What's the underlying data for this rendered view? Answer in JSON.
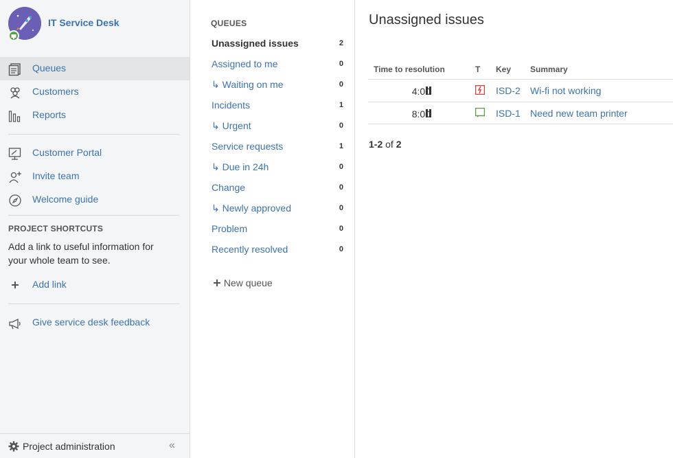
{
  "project": {
    "name": "IT Service Desk",
    "accent": "#3b73af"
  },
  "sidebar": {
    "items": [
      {
        "label": "Queues",
        "icon": "queues-icon",
        "active": true
      },
      {
        "label": "Customers",
        "icon": "customers-icon"
      },
      {
        "label": "Reports",
        "icon": "reports-icon"
      },
      {
        "label": "Customer Portal",
        "icon": "portal-icon"
      },
      {
        "label": "Invite team",
        "icon": "invite-icon"
      },
      {
        "label": "Welcome guide",
        "icon": "compass-icon"
      }
    ],
    "shortcuts": {
      "title": "PROJECT SHORTCUTS",
      "text": "Add a link to useful information for your whole team to see.",
      "add_link": "Add link"
    },
    "feedback": "Give service desk feedback",
    "footer": {
      "label": "Project administration",
      "collapse": "«"
    }
  },
  "queues": {
    "title": "QUEUES",
    "items": [
      {
        "label": "Unassigned issues",
        "count": "2",
        "active": true
      },
      {
        "label": "Assigned to me",
        "count": "0"
      },
      {
        "label": "↳ Waiting on me",
        "count": "0"
      },
      {
        "label": "Incidents",
        "count": "1"
      },
      {
        "label": "↳ Urgent",
        "count": "0"
      },
      {
        "label": "Service requests",
        "count": "1"
      },
      {
        "label": "↳ Due in 24h",
        "count": "0"
      },
      {
        "label": "Change",
        "count": "0"
      },
      {
        "label": "↳ Newly approved",
        "count": "0"
      },
      {
        "label": "Problem",
        "count": "0"
      },
      {
        "label": "Recently resolved",
        "count": "0"
      }
    ],
    "new_queue": "New queue"
  },
  "main": {
    "title": "Unassigned issues",
    "columns": {
      "time": "Time to resolution",
      "type": "T",
      "key": "Key",
      "summary": "Summary"
    },
    "rows": [
      {
        "time": "4:00",
        "type": "incident-icon",
        "key": "ISD-2",
        "summary": "Wi-fi not working"
      },
      {
        "time": "8:00",
        "type": "service-request-icon",
        "key": "ISD-1",
        "summary": "Need new team printer"
      }
    ],
    "pager": {
      "range": "1-2",
      "of": "of",
      "total": "2"
    }
  }
}
